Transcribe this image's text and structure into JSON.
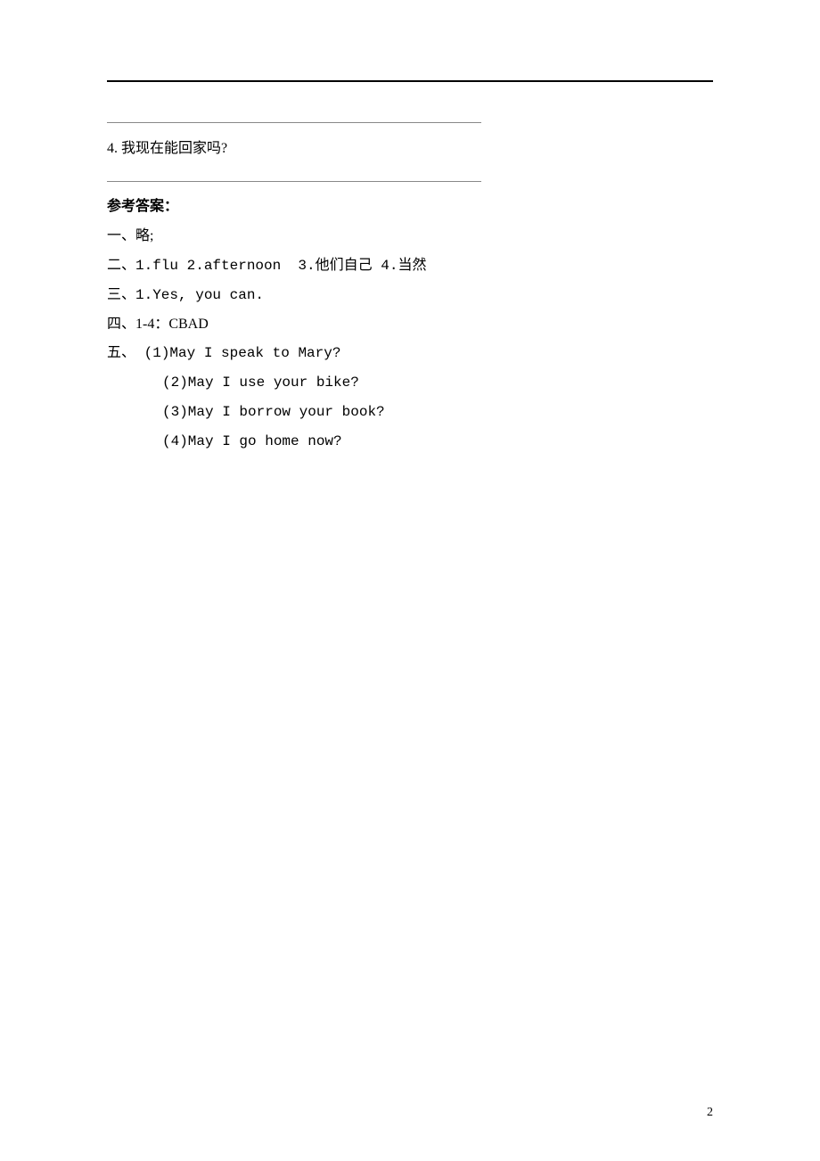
{
  "page_number": "2",
  "question4": {
    "label": "4. 我现在能回家吗?"
  },
  "answer_heading": "参考答案：",
  "answers": {
    "one": "一、略;",
    "two": "二、1.flu 2.afternoon  3.他们自己 4.当然",
    "three": "三、1.Yes, you can.",
    "four": "四、1-4：CBAD",
    "five_prefix": "五、 ",
    "five_items": [
      "(1)May I speak to Mary?",
      "(2)May I use your bike?",
      "(3)May I borrow your book?",
      "(4)May I go home now?"
    ]
  }
}
